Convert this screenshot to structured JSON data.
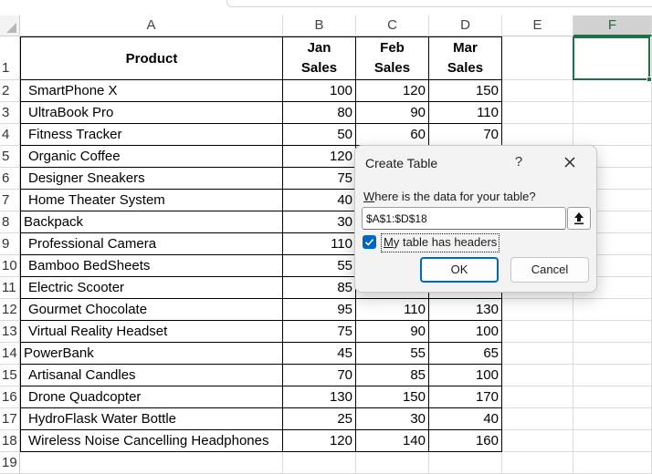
{
  "columns": [
    "A",
    "B",
    "C",
    "D",
    "E",
    "F"
  ],
  "selected_column": "F",
  "header_row": {
    "product": "Product",
    "jan_1": "Jan",
    "jan_2": "Sales",
    "feb_1": "Feb",
    "feb_2": "Sales",
    "mar_1": "Mar",
    "mar_2": "Sales"
  },
  "rows": [
    {
      "num": "2",
      "product": "SmartPhone X",
      "jan": "100",
      "feb": "120",
      "mar": "150"
    },
    {
      "num": "3",
      "product": "UltraBook Pro",
      "jan": "80",
      "feb": "90",
      "mar": "110"
    },
    {
      "num": "4",
      "product": "Fitness Tracker",
      "jan": "50",
      "feb": "60",
      "mar": "70"
    },
    {
      "num": "5",
      "product": "Organic Coffee",
      "jan": "120",
      "feb": "",
      "mar": ""
    },
    {
      "num": "6",
      "product": "Designer Sneakers",
      "jan": "75",
      "feb": "",
      "mar": ""
    },
    {
      "num": "7",
      "product": "Home Theater System",
      "jan": "40",
      "feb": "",
      "mar": ""
    },
    {
      "num": "8",
      "product": "Backpack",
      "jan": "30",
      "feb": "",
      "mar": ""
    },
    {
      "num": "9",
      "product": "Professional Camera",
      "jan": "110",
      "feb": "",
      "mar": ""
    },
    {
      "num": "10",
      "product": "Bamboo BedSheets",
      "jan": "55",
      "feb": "",
      "mar": ""
    },
    {
      "num": "11",
      "product": "Electric Scooter",
      "jan": "85",
      "feb": "",
      "mar": ""
    },
    {
      "num": "12",
      "product": "Gourmet Chocolate",
      "jan": "95",
      "feb": "110",
      "mar": "130"
    },
    {
      "num": "13",
      "product": "Virtual Reality Headset",
      "jan": "75",
      "feb": "90",
      "mar": "100"
    },
    {
      "num": "14",
      "product": "PowerBank",
      "jan": "45",
      "feb": "55",
      "mar": "65"
    },
    {
      "num": "15",
      "product": "Artisanal Candles",
      "jan": "70",
      "feb": "85",
      "mar": "100"
    },
    {
      "num": "16",
      "product": "Drone Quadcopter",
      "jan": "130",
      "feb": "150",
      "mar": "170"
    },
    {
      "num": "17",
      "product": "HydroFlask Water Bottle",
      "jan": "25",
      "feb": "30",
      "mar": "40"
    },
    {
      "num": "18",
      "product": "Wireless Noise Cancelling Headphones",
      "jan": "120",
      "feb": "140",
      "mar": "160"
    }
  ],
  "row_numbers": {
    "first": "1",
    "last": "19"
  },
  "dialog": {
    "title": "Create Table",
    "help": "?",
    "prompt_accel": "W",
    "prompt_rest": "here is the data for your table?",
    "range_value": "$A$1:$D$18",
    "checkbox_checked": true,
    "checkbox_label_accel": "M",
    "checkbox_label_rest": "y table has headers",
    "ok_label": "OK",
    "cancel_label": "Cancel"
  },
  "colors": {
    "accent": "#0067c0",
    "selection": "#1e7145"
  }
}
